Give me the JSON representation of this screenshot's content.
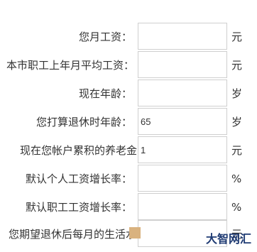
{
  "form": {
    "rows": [
      {
        "label": "您月工资：",
        "value": "",
        "unit": "元"
      },
      {
        "label": "本市职工上年月平均工资：",
        "value": "",
        "unit": "元"
      },
      {
        "label": "现在年龄：",
        "value": "",
        "unit": "岁"
      },
      {
        "label": "您打算退休时年龄：",
        "value": "65",
        "unit": "岁"
      },
      {
        "label": "现在您帐户累积的养老金",
        "value": "1",
        "unit": "元"
      },
      {
        "label": "默认个人工资增长率：",
        "value": "",
        "unit": "%"
      },
      {
        "label": "默认职工工资增长率：",
        "value": "",
        "unit": "%"
      },
      {
        "label": "您期望退休后每月的生活水",
        "value": "",
        "unit": "元"
      }
    ]
  },
  "watermark": {
    "text": "大智网汇"
  },
  "colors": {
    "text": "#333333",
    "border": "#cfcfcf",
    "watermark": "#1f3b73",
    "overlay": "#d9b27f"
  }
}
